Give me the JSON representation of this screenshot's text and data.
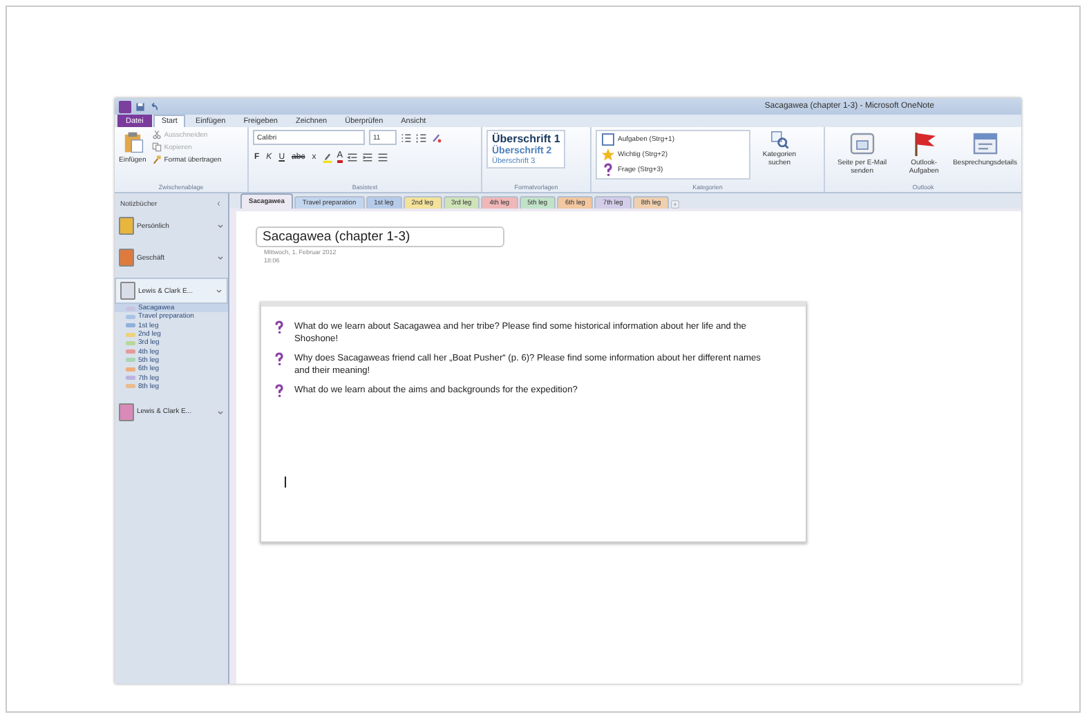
{
  "window": {
    "title": "Sacagawea (chapter 1-3) - Microsoft OneNote"
  },
  "menu_tabs": [
    {
      "label": "Datei",
      "kind": "file",
      "selected": false
    },
    {
      "label": "Start",
      "kind": "tab",
      "selected": true
    },
    {
      "label": "Einfügen",
      "kind": "tab",
      "selected": false
    },
    {
      "label": "Freigeben",
      "kind": "tab",
      "selected": false
    },
    {
      "label": "Zeichnen",
      "kind": "tab",
      "selected": false
    },
    {
      "label": "Überprüfen",
      "kind": "tab",
      "selected": false
    },
    {
      "label": "Ansicht",
      "kind": "tab",
      "selected": false
    }
  ],
  "ribbon": {
    "clipboard": {
      "label": "Zwischenablage",
      "paste": "Einfügen",
      "items": [
        {
          "label": "Ausschneiden",
          "disabled": true
        },
        {
          "label": "Kopieren",
          "disabled": true
        },
        {
          "label": "Format übertragen",
          "disabled": false
        }
      ]
    },
    "basic_text": {
      "label": "Basistext",
      "font": "Calibri",
      "size": "11",
      "format_buttons": [
        {
          "label": "F",
          "kind": "bold"
        },
        {
          "label": "K",
          "kind": "italic"
        },
        {
          "label": "U",
          "kind": "underline"
        },
        {
          "label": "abc",
          "kind": "strike"
        },
        {
          "label": "x",
          "kind": "subscript"
        }
      ],
      "font_color": "A"
    },
    "styles": {
      "label": "Formatvorlagen",
      "items": [
        {
          "label": "Überschrift 1",
          "kind": "h1"
        },
        {
          "label": "Überschrift 2",
          "kind": "h2"
        },
        {
          "label": "Überschrift 3",
          "kind": "h3"
        }
      ]
    },
    "tags": {
      "label": "Kategorien",
      "items": [
        {
          "label": "Aufgaben (Strg+1)",
          "kind": "todo"
        },
        {
          "label": "Wichtig (Strg+2)",
          "kind": "star"
        },
        {
          "label": "Frage (Strg+3)",
          "kind": "question"
        }
      ],
      "find": "Kategorien suchen"
    },
    "outlook": {
      "label": "Outlook",
      "buttons": [
        {
          "label": "Seite per E-Mail senden",
          "kind": "mail"
        },
        {
          "label": "Outlook-Aufgaben",
          "kind": "flag"
        },
        {
          "label": "Besprechungsdetails",
          "kind": "meeting"
        }
      ]
    }
  },
  "sidebar": {
    "header": "Notizbücher",
    "notebooks": [
      {
        "name": "Persönlich",
        "color": "#e8b63c",
        "expanded": false
      },
      {
        "name": "Geschäft",
        "color": "#e07a3c",
        "expanded": false
      },
      {
        "name": "Lewis & Clark E...",
        "color": "#d8dde8",
        "expanded": true,
        "sections": [
          {
            "name": "Sacagawea",
            "color": "#c9c3df",
            "selected": true
          },
          {
            "name": "Travel preparation",
            "color": "#a9c3e6",
            "selected": false
          },
          {
            "name": "1st leg",
            "color": "#8fb0dc",
            "selected": false
          },
          {
            "name": "2nd leg",
            "color": "#eed27a",
            "selected": false
          },
          {
            "name": "3rd leg",
            "color": "#b9d79a",
            "selected": false
          },
          {
            "name": "4th leg",
            "color": "#e59a9a",
            "selected": false
          },
          {
            "name": "5th leg",
            "color": "#a9d6b2",
            "selected": false
          },
          {
            "name": "6th leg",
            "color": "#eeae7c",
            "selected": false
          },
          {
            "name": "7th leg",
            "color": "#bdb3e0",
            "selected": false
          },
          {
            "name": "8th leg",
            "color": "#e9bc8c",
            "selected": false
          }
        ]
      },
      {
        "name": "Lewis & Clark E...",
        "color": "#d98ab8",
        "expanded": false
      }
    ]
  },
  "section_tabs": [
    {
      "label": "Sacagawea",
      "color": "#ece9f3",
      "selected": true
    },
    {
      "label": "Travel preparation",
      "color": "#c3d6ef",
      "selected": false
    },
    {
      "label": "1st leg",
      "color": "#b6cbe9",
      "selected": false
    },
    {
      "label": "2nd leg",
      "color": "#f3e29a",
      "selected": false
    },
    {
      "label": "3rd leg",
      "color": "#cfe3b8",
      "selected": false
    },
    {
      "label": "4th leg",
      "color": "#efb7b7",
      "selected": false
    },
    {
      "label": "5th leg",
      "color": "#c2e2c8",
      "selected": false
    },
    {
      "label": "6th leg",
      "color": "#f3c7a0",
      "selected": false
    },
    {
      "label": "7th leg",
      "color": "#d3cdea",
      "selected": false
    },
    {
      "label": "8th leg",
      "color": "#f0cfae",
      "selected": false
    }
  ],
  "page": {
    "title": "Sacagawea (chapter 1-3)",
    "date": "Mittwoch, 1. Februar 2012",
    "time": "18:06",
    "questions": [
      {
        "text": "What do we learn about Sacagawea and her tribe? Please find some historical information  about her life and the Shoshone!"
      },
      {
        "text": "Why does Sacagaweas friend call her „Boat Pusher“ (p. 6)? Please find some information  about her different names and their meaning!"
      },
      {
        "text": "What do we learn about the aims and backgrounds for the expedition?"
      }
    ]
  }
}
